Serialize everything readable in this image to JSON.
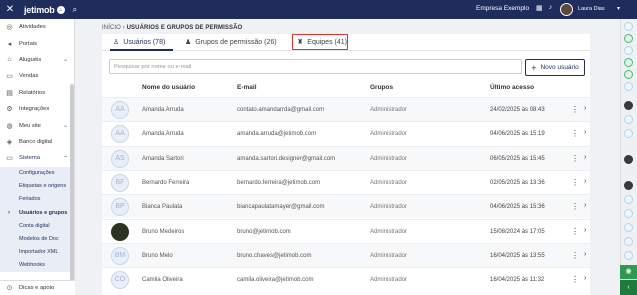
{
  "topbar": {
    "close_icon": "close-icon",
    "logo_text": "jetimob",
    "logo_mark": "⌂",
    "company": "Empresa Exemplo",
    "user_name": "Laura Dias"
  },
  "sidebar": {
    "items": [
      {
        "label": "Atividades",
        "icon": "check-circle-icon",
        "glyph": "◎"
      },
      {
        "label": "Portais",
        "icon": "megaphone-icon",
        "glyph": "◂"
      },
      {
        "label": "Aluguéis",
        "icon": "tag-icon",
        "glyph": "⌂",
        "chevron": "⌄"
      },
      {
        "label": "Vendas",
        "icon": "cash-icon",
        "glyph": "▭"
      },
      {
        "label": "Relatórios",
        "icon": "report-icon",
        "glyph": "▤"
      },
      {
        "label": "Integrações",
        "icon": "integration-icon",
        "glyph": "⚙"
      },
      {
        "label": "Meu site",
        "icon": "globe-icon",
        "glyph": "◍",
        "chevron": "⌄"
      },
      {
        "label": "Banco digital",
        "icon": "bank-icon",
        "glyph": "◈"
      },
      {
        "label": "Sistema",
        "icon": "monitor-icon",
        "glyph": "▭",
        "chevron": "⌃"
      }
    ],
    "sub_items": [
      {
        "label": "Configurações"
      },
      {
        "label": "Etiquetas e origens"
      },
      {
        "label": "Feriados"
      },
      {
        "label": "Usuários e grupos"
      },
      {
        "label": "Conta digital"
      },
      {
        "label": "Modelos de Doc"
      },
      {
        "label": "Importador XML"
      },
      {
        "label": "Webhooks"
      }
    ],
    "footer": "Dicas e apoio"
  },
  "breadcrumb": {
    "home": "INÍCIO",
    "separator": "›",
    "current": "USUÁRIOS E GRUPOS DE PERMISSÃO"
  },
  "tabs": [
    {
      "label": "Usuários (78)"
    },
    {
      "label": "Grupos de permissão (26)"
    },
    {
      "label": "Equipes (41)"
    }
  ],
  "search": {
    "placeholder": "Pesquisar por nome ou e-mail"
  },
  "new_user_label": "Novo usuário",
  "table": {
    "headers": {
      "name": "Nome do usuário",
      "email": "E-mail",
      "groups": "Grupos",
      "last_access": "Último acesso"
    },
    "rows": [
      {
        "initials": "AA",
        "name": "Amanda Arruda",
        "email": "contato.amandarrda@gmail.com",
        "group": "Administrador",
        "last_access": "24/02/2025 às 08:43"
      },
      {
        "initials": "AA",
        "name": "Amanda Arruda",
        "email": "amanda.arruda@jetimob.com",
        "group": "Administrador",
        "last_access": "04/06/2025 às 15:19"
      },
      {
        "initials": "AS",
        "name": "Amanda Sartori",
        "email": "amanda.sartori.designer@gmail.com",
        "group": "Administrador",
        "last_access": "06/05/2025 às 15:45"
      },
      {
        "initials": "BF",
        "name": "Bernardo Ferreira",
        "email": "bernardo.ferreira@jetimob.com",
        "group": "Administrador",
        "last_access": "02/05/2025 às 13:36"
      },
      {
        "initials": "BP",
        "name": "Bianca Paulata",
        "email": "biancapaulatamayer@gmail.com",
        "group": "Administrador",
        "last_access": "04/06/2025 às 15:36"
      },
      {
        "initials": "",
        "name": "Bruno Medeiros",
        "email": "bruno@jetimob.com",
        "group": "Administrador",
        "last_access": "15/08/2024 às 17:05"
      },
      {
        "initials": "BM",
        "name": "Bruno Melo",
        "email": "bruno.chaves@jetimob.com",
        "group": "Administrador",
        "last_access": "16/04/2025 às 13:55"
      },
      {
        "initials": "CO",
        "name": "Camila Oliveira",
        "email": "camila.oliveira@jetimob.com",
        "group": "Administrador",
        "last_access": "16/04/2025 às 11:32"
      }
    ]
  },
  "colors": {
    "primary": "#1f2d5c",
    "highlight": "#e03030",
    "green": "#2f9a52"
  }
}
